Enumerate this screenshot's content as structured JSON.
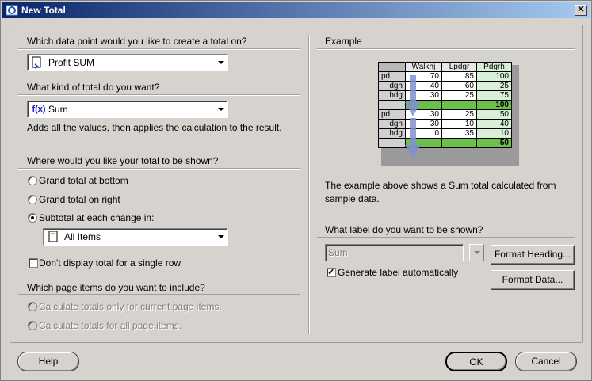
{
  "window": {
    "title": "New Total"
  },
  "left": {
    "q_data_point": "Which data point would you like to create a total on?",
    "data_point_value": "Profit SUM",
    "q_kind": "What kind of total do you want?",
    "kind_value": "Sum",
    "kind_desc": "Adds all the values, then applies the calculation to the result.",
    "q_where": "Where would you like your total to be shown?",
    "opt_grand_bottom": "Grand total at bottom",
    "opt_grand_right": "Grand total on right",
    "opt_subtotal": "Subtotal at each change in:",
    "subtotal_value": "All Items",
    "dont_display": "Don't display total for a single row",
    "q_page_items": "Which page items do you want to include?",
    "opt_current_page": "Calculate totals only for current page items.",
    "opt_all_page": "Calculate totals for all page items."
  },
  "right": {
    "example_title": "Example",
    "table_headers": [
      "Walkhj",
      "Lpdgr",
      "Pdgrh"
    ],
    "group1_rows": [
      {
        "label": "pd",
        "values": [
          "70",
          "85",
          "100"
        ]
      },
      {
        "label": "dgh",
        "values": [
          "40",
          "60",
          "25"
        ]
      },
      {
        "label": "hdg",
        "values": [
          "30",
          "25",
          "75"
        ]
      }
    ],
    "group1_total": "100",
    "group2_rows": [
      {
        "label": "pd",
        "values": [
          "30",
          "25",
          "50"
        ]
      },
      {
        "label": "dgh",
        "values": [
          "30",
          "10",
          "40"
        ]
      },
      {
        "label": "hdg",
        "values": [
          "0",
          "35",
          "10"
        ]
      }
    ],
    "group2_total": "50",
    "example_desc_1": "The example above shows a Sum total calculated from",
    "example_desc_2": "sample data.",
    "q_label": "What label do you want to be shown?",
    "label_placeholder": "Sum",
    "generate_label": "Generate label automatically",
    "format_heading": "Format Heading...",
    "format_data": "Format Data..."
  },
  "footer": {
    "help": "Help",
    "ok": "OK",
    "cancel": "Cancel"
  },
  "colors": {
    "total_green": "#6cbf4a",
    "light_green": "#d8f0d8",
    "arrow_blue": "#8090d0"
  },
  "icons": {
    "app": "oracle-app-icon",
    "data_point": "data-point-icon",
    "function": "fx-icon",
    "items": "page-icon"
  }
}
